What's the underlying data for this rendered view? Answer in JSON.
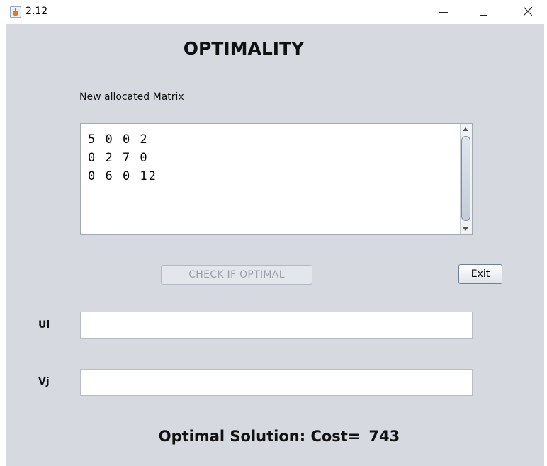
{
  "window": {
    "title": "2.12",
    "icon": "java-icon",
    "controls": {
      "minimize": "minimize-icon",
      "maximize": "maximize-icon",
      "close": "close-icon"
    }
  },
  "main": {
    "heading": "OPTIMALITY",
    "matrix_label": "New allocated Matrix",
    "matrix_text": "5 0 0 2\n0 2 7 0\n0 6 0 12",
    "check_button_label": "CHECK IF OPTIMAL",
    "check_button_enabled": false,
    "exit_button_label": "Exit",
    "ui_label": "Ui",
    "ui_value": "",
    "vj_label": "Vj",
    "vj_value": "",
    "result_label": "Optimal Solution: Cost=",
    "result_value": "743"
  },
  "colors": {
    "client_background": "#d6d9df",
    "disabled_text": "#9aa0a8"
  }
}
